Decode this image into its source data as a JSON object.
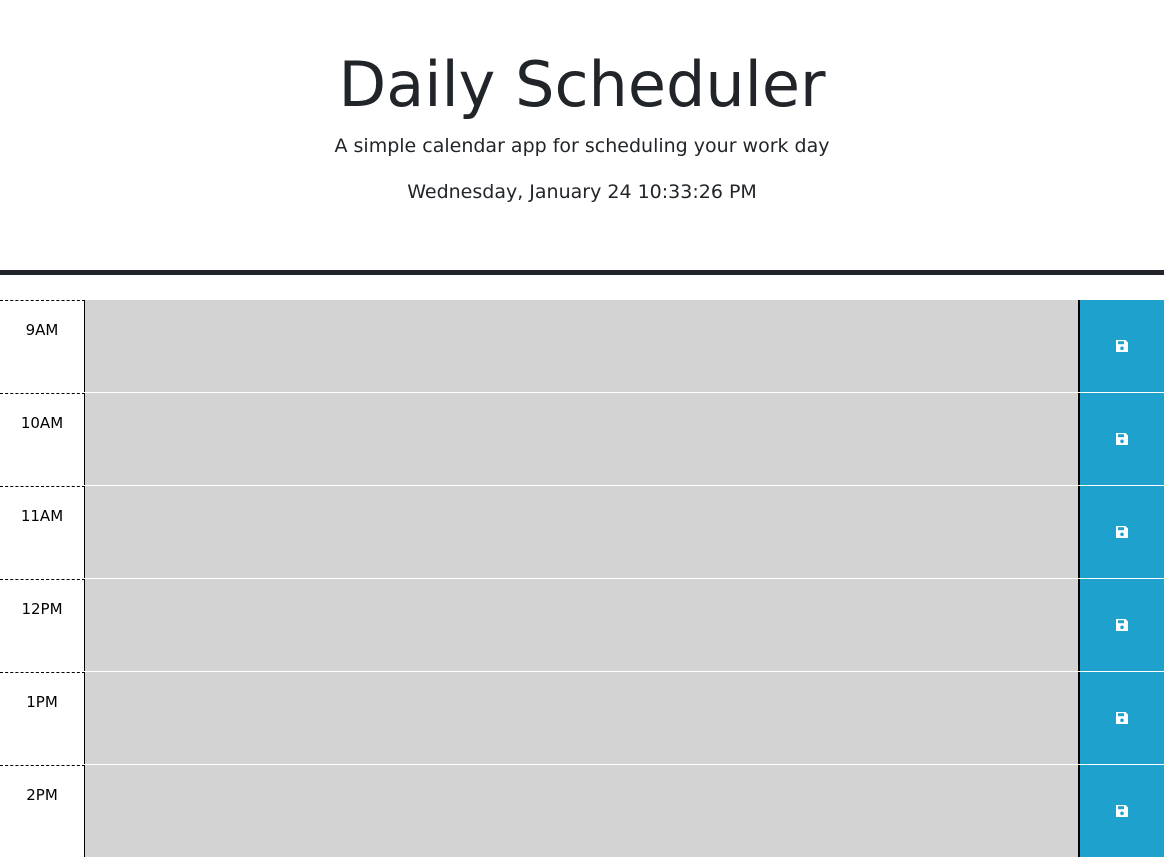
{
  "header": {
    "title": "Daily Scheduler",
    "subtitle": "A simple calendar app for scheduling your work day",
    "current_day": "Wednesday, January 24 10:33:26 PM"
  },
  "colors": {
    "save_button": "#1ea2cd",
    "time_block": "#d3d3d3",
    "divider": "#212529"
  },
  "time_blocks": [
    {
      "hour": "9AM",
      "text": "",
      "save_icon": "save-icon"
    },
    {
      "hour": "10AM",
      "text": "",
      "save_icon": "save-icon"
    },
    {
      "hour": "11AM",
      "text": "",
      "save_icon": "save-icon"
    },
    {
      "hour": "12PM",
      "text": "",
      "save_icon": "save-icon"
    },
    {
      "hour": "1PM",
      "text": "",
      "save_icon": "save-icon"
    },
    {
      "hour": "2PM",
      "text": "",
      "save_icon": "save-icon"
    }
  ]
}
